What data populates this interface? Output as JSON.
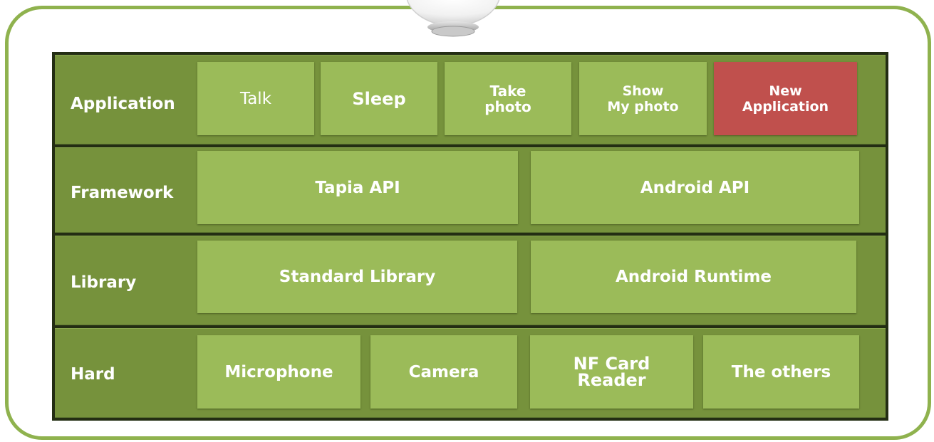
{
  "colors": {
    "frame_border": "#8fb24e",
    "row_bg": "#76923c",
    "box_bg": "#9bbb59",
    "highlight_box_bg": "#c0504d",
    "stack_border": "#232d13",
    "text": "#ffffff"
  },
  "robot": {
    "icon": "tapia-robot-icon"
  },
  "layers": {
    "application": {
      "label": "Application",
      "items": [
        "Talk",
        "Sleep",
        "Take\nphoto",
        "Show\nMy photo",
        "New\nApplication"
      ]
    },
    "framework": {
      "label": "Framework",
      "items": [
        "Tapia API",
        "Android API"
      ]
    },
    "library": {
      "label": "Library",
      "items": [
        "Standard Library",
        "Android Runtime"
      ]
    },
    "hard": {
      "label": "Hard",
      "items": [
        "Microphone",
        "Camera",
        "NF Card\nReader",
        "The others"
      ]
    }
  }
}
